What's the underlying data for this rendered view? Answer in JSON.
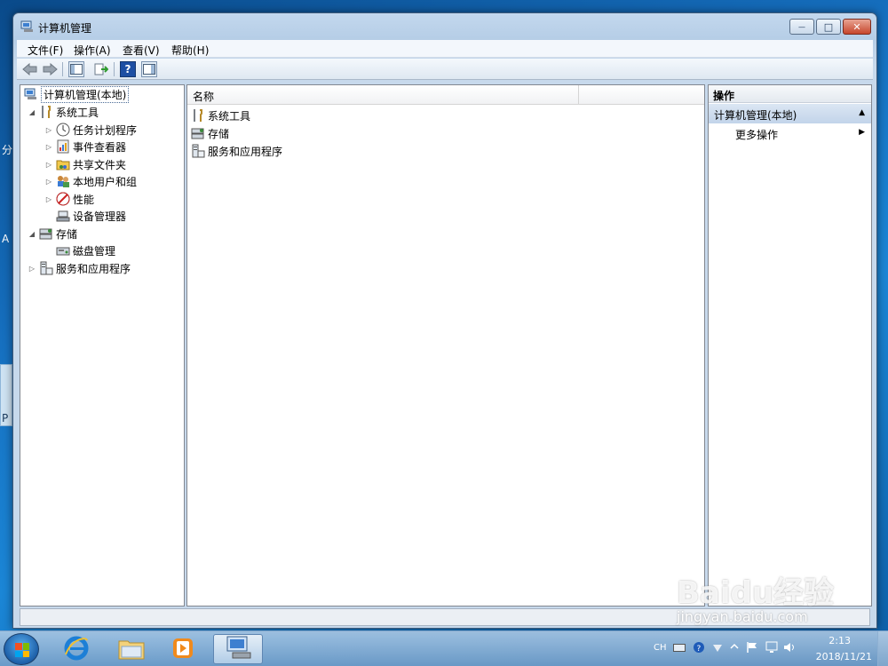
{
  "desktop": {
    "edge_labels": [
      "分",
      "A",
      "P"
    ]
  },
  "window": {
    "title": "计算机管理",
    "controls": {
      "minimize": "—",
      "maximize": "□",
      "close": "✕"
    }
  },
  "menu": [
    "文件(F)",
    "操作(A)",
    "查看(V)",
    "帮助(H)"
  ],
  "toolbar": {
    "back": "back-arrow",
    "forward": "forward-arrow",
    "show_hide_tree": "console-tree",
    "export": "export-list",
    "help": "?",
    "show_hide_action": "action-pane"
  },
  "tree": {
    "root": "计算机管理(本地)",
    "system_tools": "系统工具",
    "task_scheduler": "任务计划程序",
    "event_viewer": "事件查看器",
    "shared_folders": "共享文件夹",
    "local_users": "本地用户和组",
    "performance": "性能",
    "device_manager": "设备管理器",
    "storage": "存储",
    "disk_management": "磁盘管理",
    "services_apps": "服务和应用程序"
  },
  "list": {
    "column_name": "名称",
    "items": [
      "系统工具",
      "存储",
      "服务和应用程序"
    ]
  },
  "actions": {
    "header": "操作",
    "section": "计算机管理(本地)",
    "more": "更多操作"
  },
  "taskbar": {
    "language": "CH",
    "time": "2:13",
    "date": "2018/11/21"
  },
  "watermark": {
    "logo": "Baidu经验",
    "url": "jingyan.baidu.com"
  },
  "colors": {
    "desktop": "#1670c0",
    "window_frame": "#b5cde6",
    "selection": "#c2d4ea"
  }
}
